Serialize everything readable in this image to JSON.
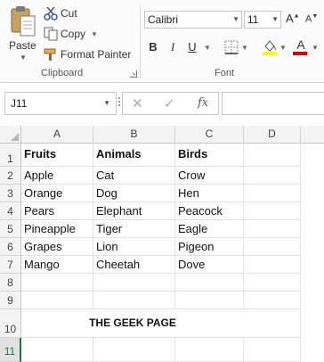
{
  "clipboard": {
    "paste_label": "Paste",
    "cut_label": "Cut",
    "copy_label": "Copy",
    "format_painter_label": "Format Painter",
    "group_label": "Clipboard"
  },
  "font": {
    "family": "Calibri",
    "size": "11",
    "grow_label": "A",
    "shrink_label": "A",
    "bold_label": "B",
    "italic_label": "I",
    "underline_label": "U",
    "font_color_label": "A",
    "group_label": "Font"
  },
  "formula_bar": {
    "name_box": "J11",
    "fx_label": "fx",
    "formula": ""
  },
  "grid": {
    "columns": [
      "A",
      "B",
      "C",
      "D"
    ],
    "rows": [
      "1",
      "2",
      "3",
      "4",
      "5",
      "6",
      "7",
      "8",
      "9",
      "10",
      "11"
    ],
    "cells": [
      [
        "Fruits",
        "Animals",
        "Birds"
      ],
      [
        "Apple",
        "Cat",
        "Crow"
      ],
      [
        "Orange",
        "Dog",
        "Hen"
      ],
      [
        "Pears",
        "Elephant",
        "Peacock"
      ],
      [
        "Pineapple",
        "Tiger",
        "Eagle"
      ],
      [
        "Grapes",
        "Lion",
        "Pigeon"
      ],
      [
        "Mango",
        "Cheetah",
        "Dove"
      ]
    ],
    "title": "THE GEEK PAGE",
    "selected_row": "11"
  },
  "colors": {
    "accent_green": "#217346",
    "highlight_yellow": "#ffff00",
    "font_red": "#e00000"
  }
}
